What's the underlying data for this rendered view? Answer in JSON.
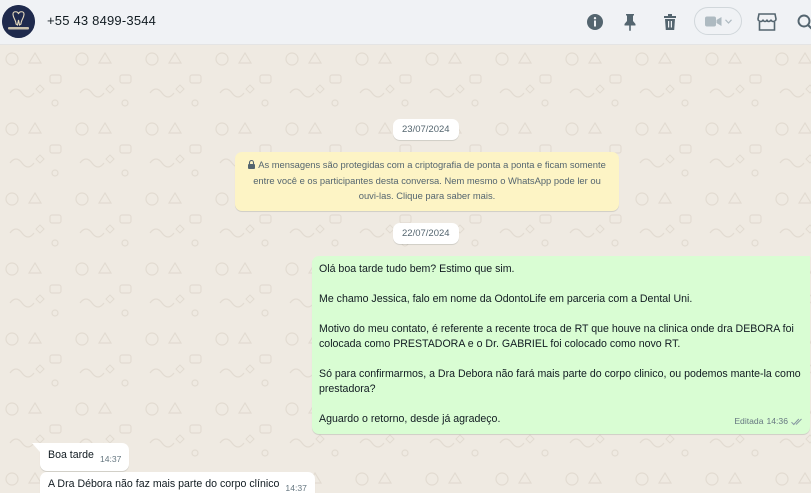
{
  "header": {
    "contact_name": "+55 43 8499-3544",
    "avatar_text": "ODONTOLIFE",
    "icons": [
      "info-icon",
      "pin-icon",
      "delete-icon",
      "video-call-icon",
      "store-icon",
      "search-icon"
    ]
  },
  "chat": {
    "date_chip_1": "23/07/2024",
    "encryption_notice": "As mensagens são protegidas com a criptografia de ponta a ponta e ficam somente entre você e os participantes desta conversa. Nem mesmo o WhatsApp pode ler ou ouvi-las. Clique para saber mais.",
    "date_chip_2": "22/07/2024",
    "outgoing_message": {
      "text": "Olá boa tarde tudo bem? Estimo que sim.\n\nMe chamo Jessica, falo em nome da OdontoLife em parceria com a Dental Uni.\n\nMotivo do meu contato, é referente a recente troca de RT que houve na clinica onde dra DEBORA foi colocada como PRESTADORA e o Dr. GABRIEL foi colocado como novo RT.\n\nSó para confirmarmos, a Dra Debora não fará mais parte do corpo clinico, ou podemos mante-la como prestadora?\n\nAguardo o retorno, desde já agradeço.",
      "edited_label": "Editada",
      "time": "14:36"
    },
    "incoming_messages": [
      {
        "text": "Boa tarde",
        "time": "14:37"
      },
      {
        "text": "A Dra Débora não faz mais parte do corpo clínico",
        "time": "14:37"
      }
    ]
  },
  "colors": {
    "header_bg": "#f0f2f5",
    "chat_bg": "#efeae2",
    "outgoing_bubble": "#d9fdd3",
    "incoming_bubble": "#ffffff",
    "encryption_bg": "#fdf4c5",
    "icon": "#54656f",
    "read_check": "#8696a0"
  }
}
